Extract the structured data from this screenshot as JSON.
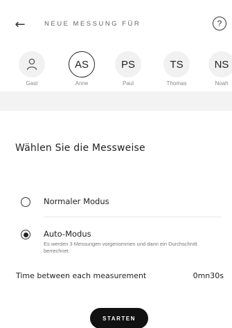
{
  "header": {
    "back_icon": "arrow-left-icon",
    "title": "NEUE MESSUNG FÜR",
    "help_icon": "question-circle-icon",
    "help_glyph": "?"
  },
  "profiles": [
    {
      "initials": "",
      "icon": "person-icon",
      "label": "Gast",
      "selected": false
    },
    {
      "initials": "AS",
      "label": "Anne",
      "selected": true
    },
    {
      "initials": "PS",
      "label": "Paul",
      "selected": false
    },
    {
      "initials": "TS",
      "label": "Thomas",
      "selected": false
    },
    {
      "initials": "NS",
      "label": "Noah",
      "selected": false
    }
  ],
  "main": {
    "section_title": "Wählen Sie die Messweise",
    "options": [
      {
        "label": "Normaler Modus",
        "selected": false,
        "description": ""
      },
      {
        "label": "Auto-Modus",
        "selected": true,
        "description": "Es werden 3 Messungen vorgenommen und dann ein Durchschnitt berrechnet."
      }
    ],
    "time_label": "Time between each measurement",
    "time_value": "0mn30s",
    "start_label": "STARTEN"
  },
  "colors": {
    "accent": "#111111",
    "avatar_bg": "#f1f1f1",
    "divider_bg": "#f3f3f3"
  }
}
